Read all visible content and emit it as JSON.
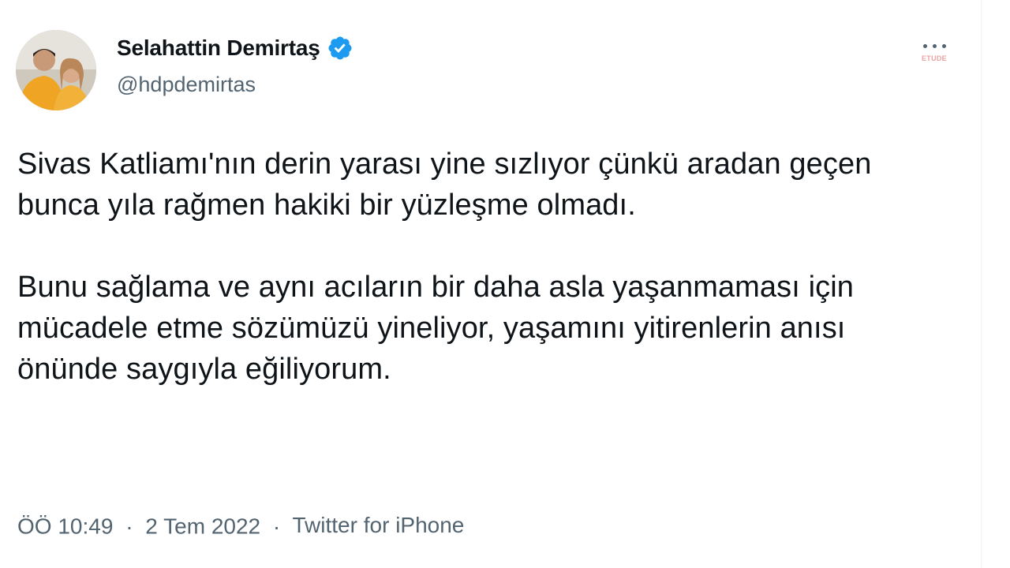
{
  "author": {
    "display_name": "Selahattin Demirtaş",
    "handle": "@hdpdemirtas",
    "verified": true,
    "avatar_icon": "profile-photo"
  },
  "menu": {
    "icon": "more-horizontal-icon",
    "watermark_text": "ETUDE"
  },
  "tweet": {
    "paragraph_1": "Sivas Katliamı'nın derin yarası yine sızlıyor çünkü aradan geçen bunca yıla rağmen hakiki bir yüzleşme olmadı.",
    "paragraph_2": "Bunu sağlama ve aynı acıların bir daha asla yaşanmaması için mücadele etme sözümüzü yineliyor, yaşamını yitirenlerin anısı önünde saygıyla eğiliyorum."
  },
  "meta": {
    "time": "ÖÖ 10:49",
    "date": "2 Tem 2022",
    "source": "Twitter for iPhone",
    "separator": "·"
  },
  "colors": {
    "text_primary": "#0f1419",
    "text_secondary": "#536471",
    "verified_blue": "#1d9bf0"
  }
}
